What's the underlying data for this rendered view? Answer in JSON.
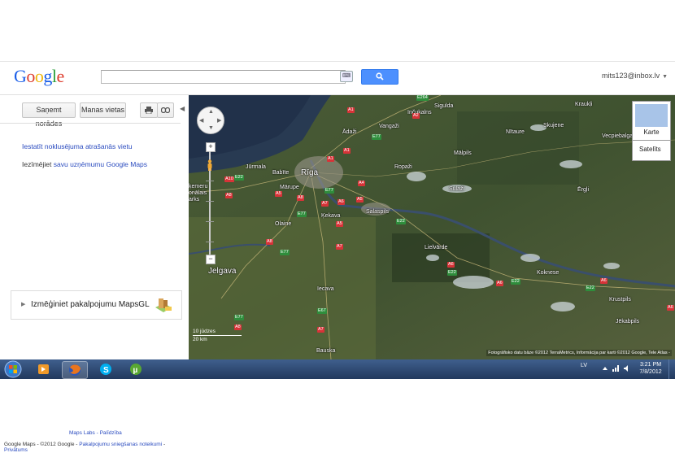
{
  "header": {
    "logo": "Google",
    "search_value": "",
    "account": "mits123@inbox.lv"
  },
  "sidebar": {
    "btn_directions": "Saņemt norādes",
    "btn_myplaces": "Manas vietas",
    "link_default_location": "Iestatīt noklusējuma atrašanās vietu",
    "save_prefix": "Iezīmējiet",
    "save_link": "savu uzņēmumu Google Maps",
    "mapsgl": "Izmēģiniet pakalpojumu MapsGL",
    "footer_labs": "Maps Labs",
    "footer_help": "Palīdzība",
    "footer_copyright": "Google Maps - ©2012 Google -",
    "footer_terms": "Pakalpojumu sniegšanas noteikumi",
    "footer_privacy": "Privātums"
  },
  "map": {
    "type_karte": "Karte",
    "type_satelite": "Satelīts",
    "scale_top": "10 jūdzes",
    "scale_bottom": "20 km",
    "copyright": "Fotogrāfisko datu bāze ©2012 TerraMetrics, Informācija par karti ©2012 Google, Tele Atlas -",
    "places": {
      "riga": "Rīga",
      "jurmala": "Jūrmala",
      "babite": "Babīte",
      "marupe": "Mārupe",
      "olaine": "Olaine",
      "kekava": "Ķekava",
      "salaspils": "Salaspils",
      "ropazi": "Ropaži",
      "sulazi": "Sulaži",
      "adazi": "Ādaži",
      "vangazi": "Vangaži",
      "sigulda": "Sigulda",
      "incukalns": "Inčukalns",
      "nitaure": "Nītaure",
      "skujene": "Skujene",
      "kraukli": "Kraukļi",
      "malpils": "Mālpils",
      "vecpiebalga": "Vecpiebalga",
      "ergli": "Ērgļi",
      "lielvarde": "Lielvārde",
      "koknese": "Koknese",
      "krustpils": "Krustpils",
      "jekabpils": "Jēkabpils",
      "jelgava": "Jelgava",
      "iecava": "Iecava",
      "bauska": "Bauska",
      "kemeru": "ķemeru",
      "nationals": "onālais",
      "parks": "arks"
    }
  },
  "taskbar": {
    "lang": "LV",
    "time": "3:21 PM",
    "date": "7/8/2012"
  }
}
